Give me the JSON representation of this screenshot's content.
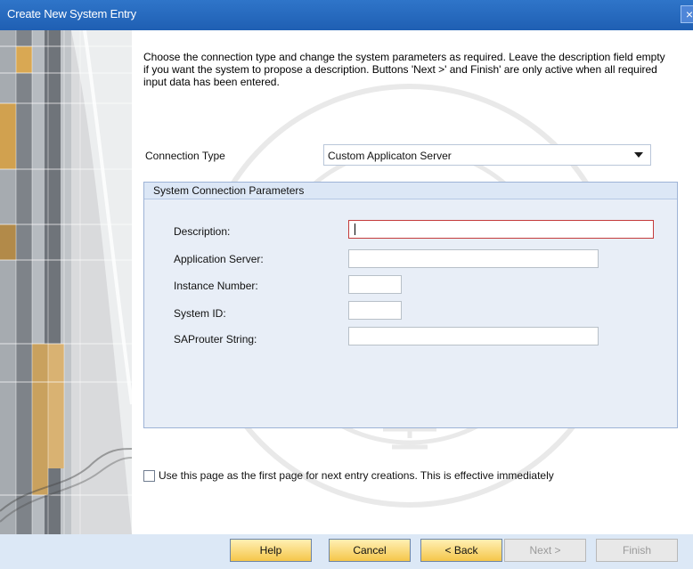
{
  "window": {
    "title": "Create New System Entry",
    "close_icon": "close-icon"
  },
  "intro": "Choose the connection type and change the system parameters as required. Leave the description field empty if you want the system to propose a description. Buttons 'Next >' and Finish' are only active when all required input data has been entered.",
  "connection": {
    "label": "Connection Type",
    "value": "Custom Applicaton Server"
  },
  "parameters": {
    "title": "System Connection Parameters",
    "description_label": "Description:",
    "description_value": "",
    "application_server_label": "Application Server:",
    "application_server_value": "",
    "instance_number_label": "Instance Number:",
    "instance_number_value": "",
    "system_id_label": "System ID:",
    "system_id_value": "",
    "saprouter_label": "SAProuter String:",
    "saprouter_value": ""
  },
  "first_page_checkbox": {
    "label": "Use this page as the first page for next entry creations. This is effective immediately",
    "checked": false
  },
  "buttons": {
    "help": "Help",
    "cancel": "Cancel",
    "back": "< Back",
    "next": "Next >",
    "finish": "Finish"
  },
  "colors": {
    "title_bar": "#1f5fb3",
    "button": "#f5c64a",
    "button_bar": "#dce8f6",
    "group_bg": "#e8eef7"
  }
}
